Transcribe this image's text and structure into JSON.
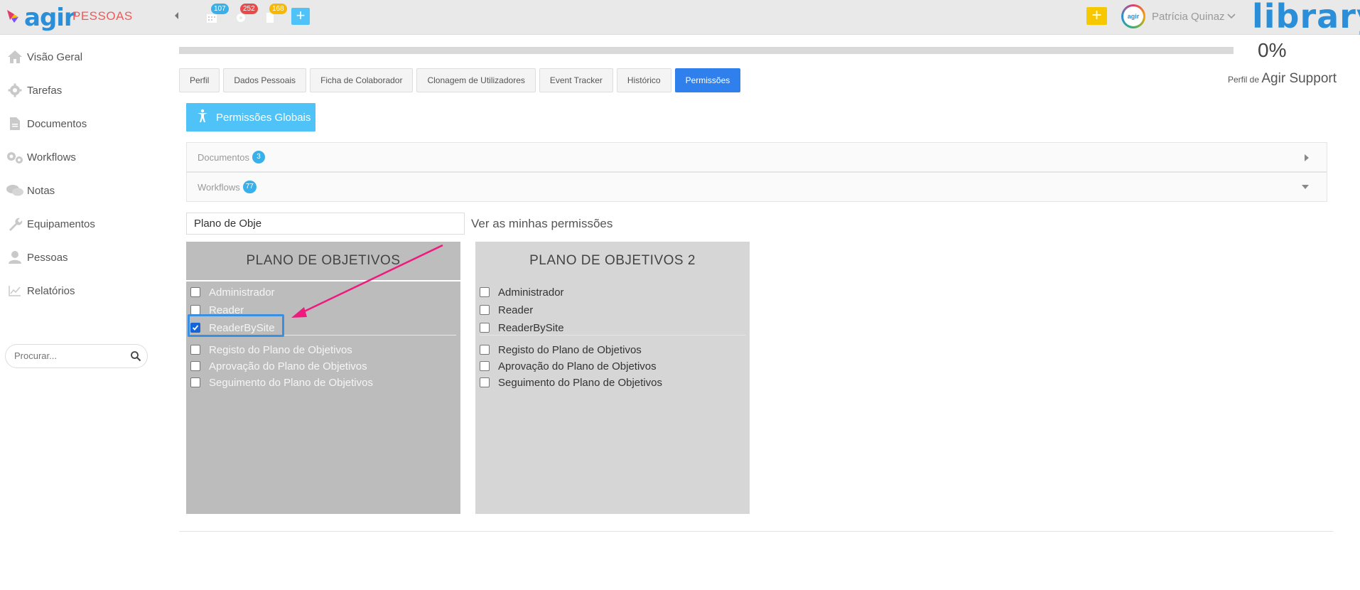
{
  "header": {
    "logo_text": "agir",
    "module": "PESSOAS",
    "notifications": [
      {
        "icon": "calendar-icon",
        "count": "107",
        "color": "#3ab0ea"
      },
      {
        "icon": "gear-icon",
        "count": "252",
        "color": "#e94b4b"
      },
      {
        "icon": "document-icon",
        "count": "168",
        "color": "#f6b800"
      }
    ],
    "add_label": "+",
    "add_yellow_label": "+",
    "avatar_text": "agir",
    "user_name": "Patrícia Quinaz",
    "brand": "library"
  },
  "sidebar": {
    "items": [
      {
        "label": "Visão Geral",
        "icon": "home-icon"
      },
      {
        "label": "Tarefas",
        "icon": "gear-icon"
      },
      {
        "label": "Documentos",
        "icon": "document-icon"
      },
      {
        "label": "Workflows",
        "icon": "gears-icon"
      },
      {
        "label": "Notas",
        "icon": "chat-icon"
      },
      {
        "label": "Equipamentos",
        "icon": "wrench-icon"
      },
      {
        "label": "Pessoas",
        "icon": "user-icon"
      },
      {
        "label": "Relatórios",
        "icon": "chart-icon"
      }
    ],
    "search_placeholder": "Procurar..."
  },
  "progress": {
    "value": 0,
    "label": "0%"
  },
  "profile": {
    "prefix": "Perfil de",
    "name": "Agir Support"
  },
  "tabs": [
    {
      "label": "Perfil",
      "active": false
    },
    {
      "label": "Dados Pessoais",
      "active": false
    },
    {
      "label": "Ficha de Colaborador",
      "active": false
    },
    {
      "label": "Clonagem de Utilizadores",
      "active": false
    },
    {
      "label": "Event Tracker",
      "active": false
    },
    {
      "label": "Histórico",
      "active": false
    },
    {
      "label": "Permissões",
      "active": true
    }
  ],
  "global_button": {
    "label": "Permissões Globais",
    "icon": "accessibility-icon"
  },
  "accordions": [
    {
      "label": "Documentos",
      "count": "3",
      "state": "collapsed"
    },
    {
      "label": "Workflows",
      "count": "77",
      "state": "expanded"
    }
  ],
  "filter": {
    "value": "Plano de Obje"
  },
  "my_permissions_link": "Ver as minhas permissões",
  "panels": [
    {
      "title": "PLANO DE OBJETIVOS",
      "roles": [
        {
          "label": "Administrador",
          "checked": false
        },
        {
          "label": "Reader",
          "checked": false
        },
        {
          "label": "ReaderBySite",
          "checked": true
        }
      ],
      "steps": [
        {
          "label": "Registo do Plano de Objetivos",
          "checked": false
        },
        {
          "label": "Aprovação do Plano de Objetivos",
          "checked": false
        },
        {
          "label": "Seguimento do Plano de Objetivos",
          "checked": false
        }
      ]
    },
    {
      "title": "PLANO DE OBJETIVOS 2",
      "roles": [
        {
          "label": "Administrador",
          "checked": false
        },
        {
          "label": "Reader",
          "checked": false
        },
        {
          "label": "ReaderBySite",
          "checked": false
        }
      ],
      "steps": [
        {
          "label": "Registo do Plano de Objetivos",
          "checked": false
        },
        {
          "label": "Aprovação do Plano de Objetivos",
          "checked": false
        },
        {
          "label": "Seguimento do Plano de Objetivos",
          "checked": false
        }
      ]
    }
  ],
  "colors": {
    "accent": "#2f80ed",
    "light_accent": "#4fc3f7",
    "annotation_arrow": "#f0197d",
    "highlight": "#3a8fe0"
  }
}
